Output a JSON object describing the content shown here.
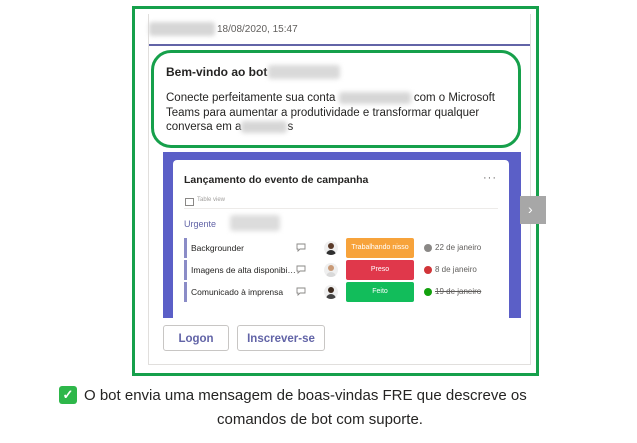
{
  "message": {
    "timestamp": "18/08/2020, 15:47"
  },
  "welcome": {
    "title": "Bem-vindo ao bot",
    "body_part1": "Conecte perfeitamente sua conta",
    "body_part2": "com o Microsoft Teams para aumentar a produtividade e transformar qualquer conversa em a",
    "body_part3": "s"
  },
  "card": {
    "title": "Lançamento do evento de campanha",
    "more_icon": "more-options-icon",
    "table_icon": "table-icon",
    "table_label": "Table view",
    "group_label": "Urgente",
    "rows": [
      {
        "name": "Backgrounder",
        "status": "Trabalhando nisso",
        "status_color": "#f7a33b",
        "date": "22 de janeiro",
        "date_icon_color": "#8a8886",
        "strike": false
      },
      {
        "name": "Imagens de alta disponibilidade",
        "status": "Preso",
        "status_color": "#e0384b",
        "date": "8 de janeiro",
        "date_icon_color": "#d13438",
        "strike": false
      },
      {
        "name": "Comunicado à imprensa",
        "status": "Feito",
        "status_color": "#12bd5b",
        "date": "19 de janeiro",
        "date_icon_color": "#13a10e",
        "strike": true
      }
    ]
  },
  "buttons": {
    "logon": "Logon",
    "subscribe": "Inscrever-se"
  },
  "caption": {
    "line1": "O bot envia uma mensagem de boas-vindas FRE que descreve os",
    "line2": "comandos de bot com suporte."
  },
  "colors": {
    "highlight": "#16a04b",
    "accent": "#6264a7",
    "card_band": "#5b5fc7"
  }
}
